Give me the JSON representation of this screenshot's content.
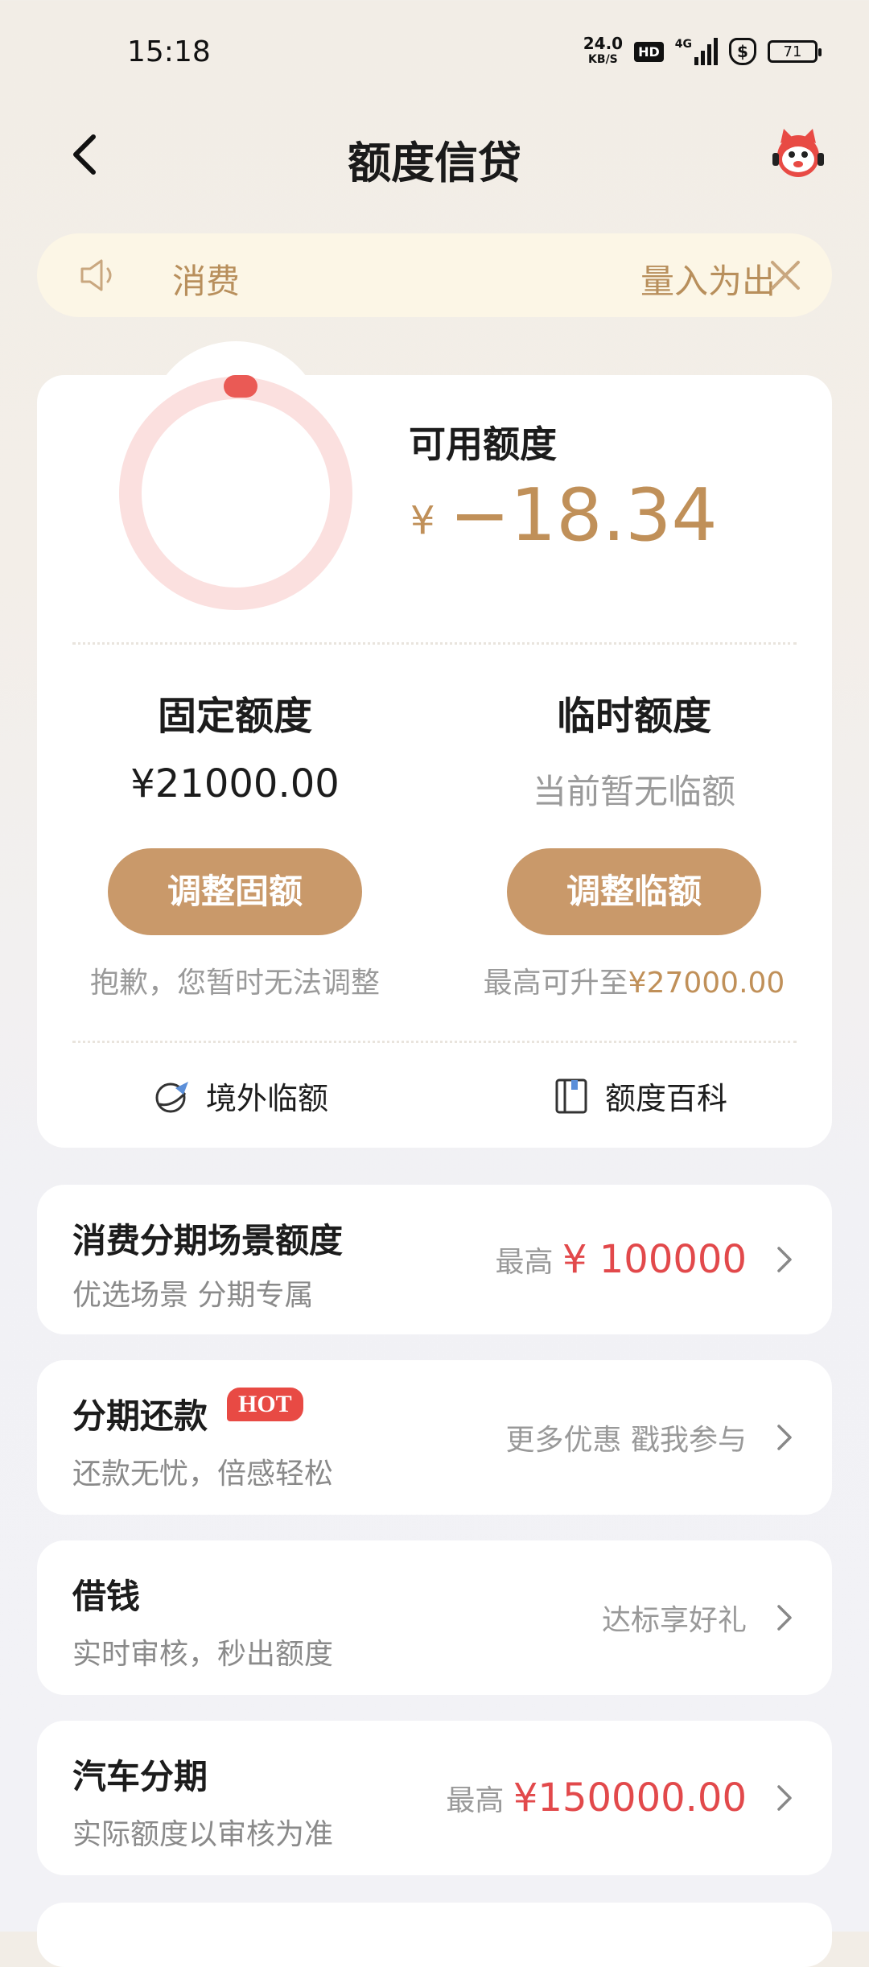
{
  "status_bar": {
    "time": "15:18",
    "net_speed": "24.0",
    "net_unit": "KB/S",
    "hd": "HD",
    "network": "4G",
    "battery": "71"
  },
  "header": {
    "title": "额度信贷"
  },
  "notice": {
    "text_left": "消费",
    "text_right": "量入为出"
  },
  "available": {
    "label": "可用额度",
    "currency": "¥",
    "value": "−18.34"
  },
  "fixed": {
    "title": "固定额度",
    "value": "¥21000.00",
    "button": "调整固额",
    "note": "抱歉，您暂时无法调整"
  },
  "temp": {
    "title": "临时额度",
    "value": "当前暂无临额",
    "button": "调整临额",
    "note_prefix": "最高可升至",
    "note_value": "¥27000.00"
  },
  "links": {
    "overseas": "境外临额",
    "wiki": "额度百科"
  },
  "rows": [
    {
      "title": "消费分期场景额度",
      "sub": "优选场景 分期专属",
      "prefix": "最高",
      "value": "¥ 100000"
    },
    {
      "title": "分期还款",
      "badge": "HOT",
      "sub": "还款无忧，倍感轻松",
      "right": "更多优惠 戳我参与"
    },
    {
      "title": "借钱",
      "sub": "实时审核，秒出额度",
      "right": "达标享好礼"
    },
    {
      "title": "汽车分期",
      "sub": "实际额度以审核为准",
      "prefix": "最高",
      "value": "¥150000.00"
    }
  ]
}
